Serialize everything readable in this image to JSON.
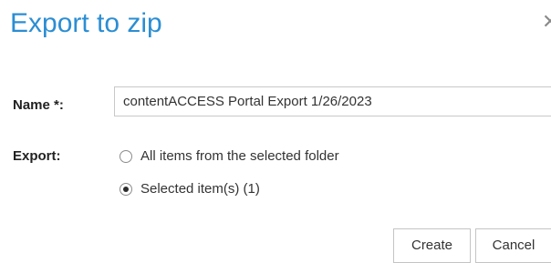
{
  "dialog": {
    "title": "Export to zip",
    "close_icon": "close-icon"
  },
  "form": {
    "name_label": "Name *:",
    "name_value": "contentACCESS Portal Export 1/26/2023",
    "export_label": "Export:",
    "options": [
      {
        "label": "All items from the selected folder",
        "selected": false
      },
      {
        "label": "Selected item(s) (1)",
        "selected": true
      }
    ]
  },
  "buttons": {
    "create_label": "Create",
    "cancel_label": "Cancel"
  },
  "colors": {
    "title": "#2b8ed3",
    "border": "#c8c8c8"
  }
}
